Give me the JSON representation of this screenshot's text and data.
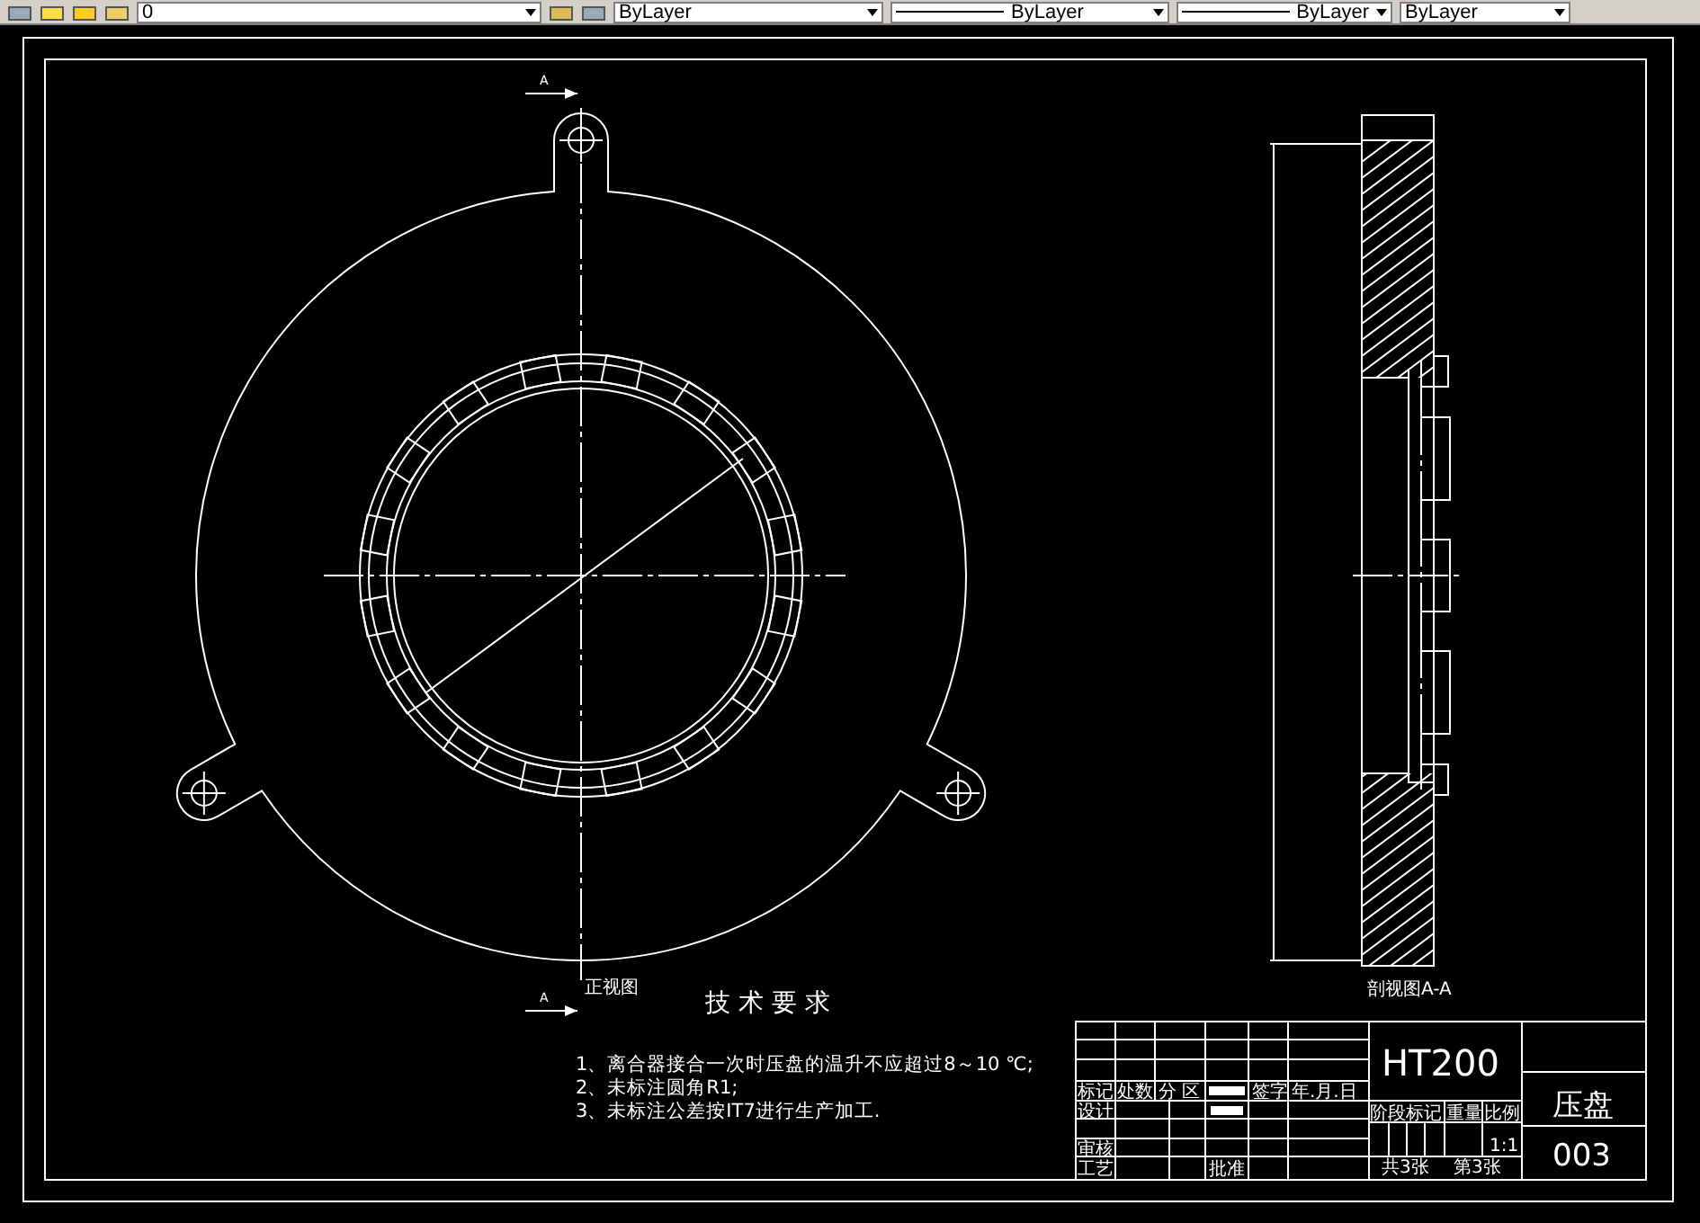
{
  "toolbar": {
    "layer": "0",
    "properties": [
      "ByLayer",
      "ByLayer",
      "ByLayer",
      "ByLayer"
    ]
  },
  "drawing": {
    "front_view_label": "正视图",
    "section_view_label": "剖视图A-A",
    "section_marks": [
      "A",
      "A"
    ]
  },
  "technical_requirements": {
    "title": "技 术 要 求",
    "items": [
      "1、离合器接合一次时压盘的温升不应超过8～10 ℃;",
      "2、未标注圆角R1;",
      "3、未标注公差按IT7进行生产加工."
    ]
  },
  "title_block": {
    "material": "HT200",
    "part_name": "压盘",
    "drawing_number": "003",
    "labels": [
      "标记",
      "处数",
      "分 区",
      "签字",
      "年.月.日",
      "设计",
      "审核",
      "工艺",
      "批准",
      "阶段标记",
      "重量",
      "比例",
      "1:1",
      "共3张",
      "第3张"
    ]
  }
}
